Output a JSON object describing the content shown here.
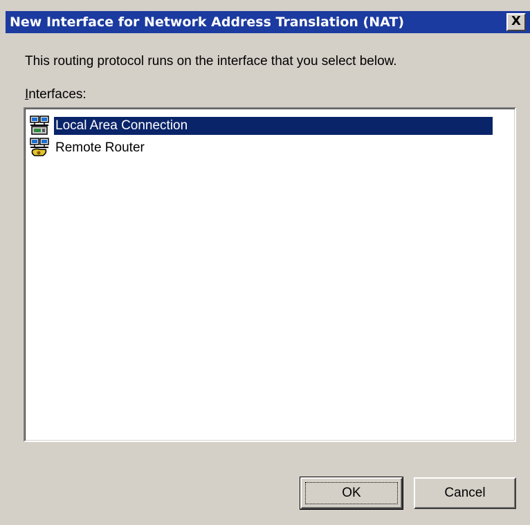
{
  "window": {
    "title": "New Interface for Network Address Translation (NAT)",
    "close_label": "X"
  },
  "description": "This routing protocol runs on the interface that you select below.",
  "interfaces_label": {
    "accesskey": "I",
    "rest": "nterfaces:"
  },
  "interfaces": [
    {
      "label": "Local Area Connection",
      "icon": "network-adapter-icon",
      "selected": true
    },
    {
      "label": "Remote Router",
      "icon": "demand-dial-router-icon",
      "selected": false
    }
  ],
  "buttons": {
    "ok_label": "OK",
    "cancel_label": "Cancel"
  },
  "colors": {
    "titlebar": "#1c3ba0",
    "selection": "#0a246a",
    "dialog_face": "#d4d0c8"
  }
}
